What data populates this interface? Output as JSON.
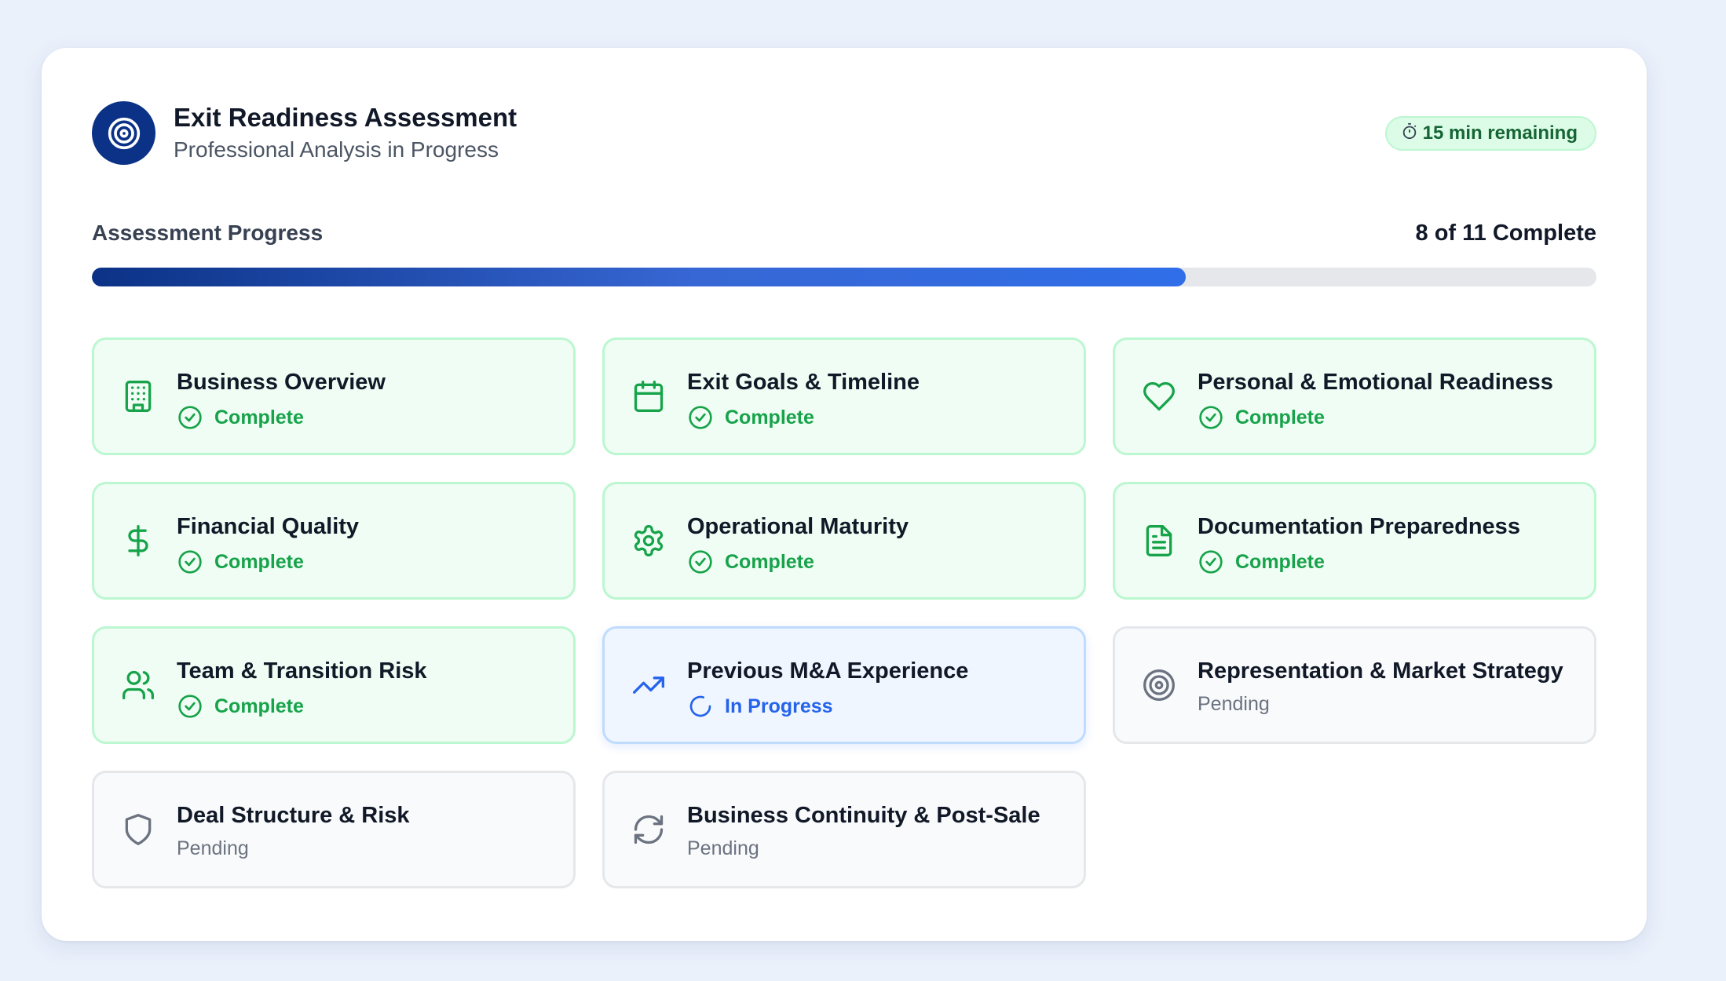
{
  "header": {
    "title": "Exit Readiness Assessment",
    "subtitle": "Professional Analysis in Progress",
    "time_remaining": "15 min remaining",
    "time_icon": "stopwatch-icon"
  },
  "progress": {
    "label": "Assessment Progress",
    "count_text": "8 of 11 Complete",
    "fraction": 0.727
  },
  "colors": {
    "brand": "#0b3286",
    "complete": "#16a34a",
    "in_progress": "#2563eb",
    "pending": "#6b7280"
  },
  "sections": [
    {
      "name": "Business Overview",
      "status": "Complete",
      "icon": "building-icon"
    },
    {
      "name": "Exit Goals & Timeline",
      "status": "Complete",
      "icon": "calendar-icon"
    },
    {
      "name": "Personal & Emotional Readiness",
      "status": "Complete",
      "icon": "heart-icon"
    },
    {
      "name": "Financial Quality",
      "status": "Complete",
      "icon": "dollar-icon"
    },
    {
      "name": "Operational Maturity",
      "status": "Complete",
      "icon": "gear-icon"
    },
    {
      "name": "Documentation Preparedness",
      "status": "Complete",
      "icon": "document-icon"
    },
    {
      "name": "Team & Transition Risk",
      "status": "Complete",
      "icon": "users-icon"
    },
    {
      "name": "Previous M&A Experience",
      "status": "In Progress",
      "icon": "trending-up-icon"
    },
    {
      "name": "Representation & Market Strategy",
      "status": "Pending",
      "icon": "target-icon"
    },
    {
      "name": "Deal Structure & Risk",
      "status": "Pending",
      "icon": "shield-icon"
    },
    {
      "name": "Business Continuity & Post-Sale",
      "status": "Pending",
      "icon": "refresh-icon"
    }
  ]
}
